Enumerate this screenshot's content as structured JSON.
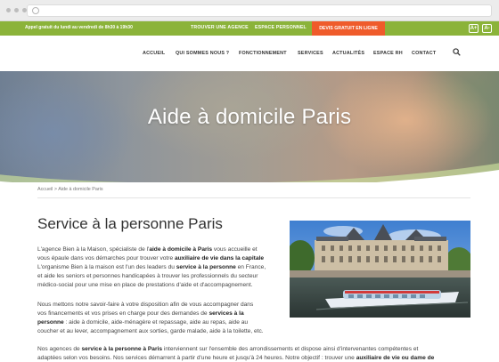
{
  "topbar": {
    "hours": "Appel gratuit du lundi au vendredi de 8h30 à 19h30",
    "link_agence": "TROUVER UNE AGENCE",
    "link_espace": "ESPACE PERSONNEL",
    "devis": "DEVIS GRATUIT EN LIGNE",
    "font_up": "A+",
    "font_down": "A-"
  },
  "nav": {
    "items": [
      "ACCUEIL",
      "QUI SOMMES NOUS ?",
      "FONCTIONNEMENT",
      "SERVICES",
      "ACTUALITÉS",
      "ESPACE RH",
      "CONTACT"
    ]
  },
  "hero": {
    "title": "Aide à domicile Paris"
  },
  "breadcrumb": "Accueil > Aide à domicile Paris",
  "page_title": "Service à la personne Paris",
  "paragraph1": {
    "l1a": "L'agence Bien à la Maison, spécialiste de l'",
    "l1b": "aide à domicile à Paris",
    "l1c": " vous accueille et",
    "l2a": "vous épaule dans vos démarches pour trouver votre ",
    "l2b": "auxiliaire de vie dans la capitale",
    "l3a": "L'organisme Bien à la maison est l'un des leaders du ",
    "l3b": "service à la personne",
    "l3c": " en France,",
    "l4": "et aide les seniors et personnes handicapées à trouver les professionnels du secteur",
    "l5": "médico-social pour une mise en place de prestations d'aide et d'accompagnement."
  },
  "paragraph2": {
    "l1": "Nous mettons notre savoir-faire à votre disposition afin de vous accompagner dans",
    "l2a": "vos financements et vos prises en charge pour des demandes de ",
    "l2b": "services à la",
    "l3a": "personne",
    "l3b": " : aide à domicile, aide-ménagère et repassage, aide au repas, aide au",
    "l4": "coucher et au lever, accompagnement aux sorties, garde malade, aide à la toilette, etc."
  },
  "paragraph3": {
    "l1a": "Nos agences de ",
    "l1b": "service à la personne à Paris",
    "l1c": " interviennent sur l'ensemble des arrondissements et dispose ainsi d'intervenantes compétentes et",
    "l2a": "adaptées selon vos besoins. Nos services démarrent à partir d'une heure et jusqu'à 24 heures. Notre objectif : trouver une ",
    "l2b": "auxiliaire de vie ou dame de"
  }
}
